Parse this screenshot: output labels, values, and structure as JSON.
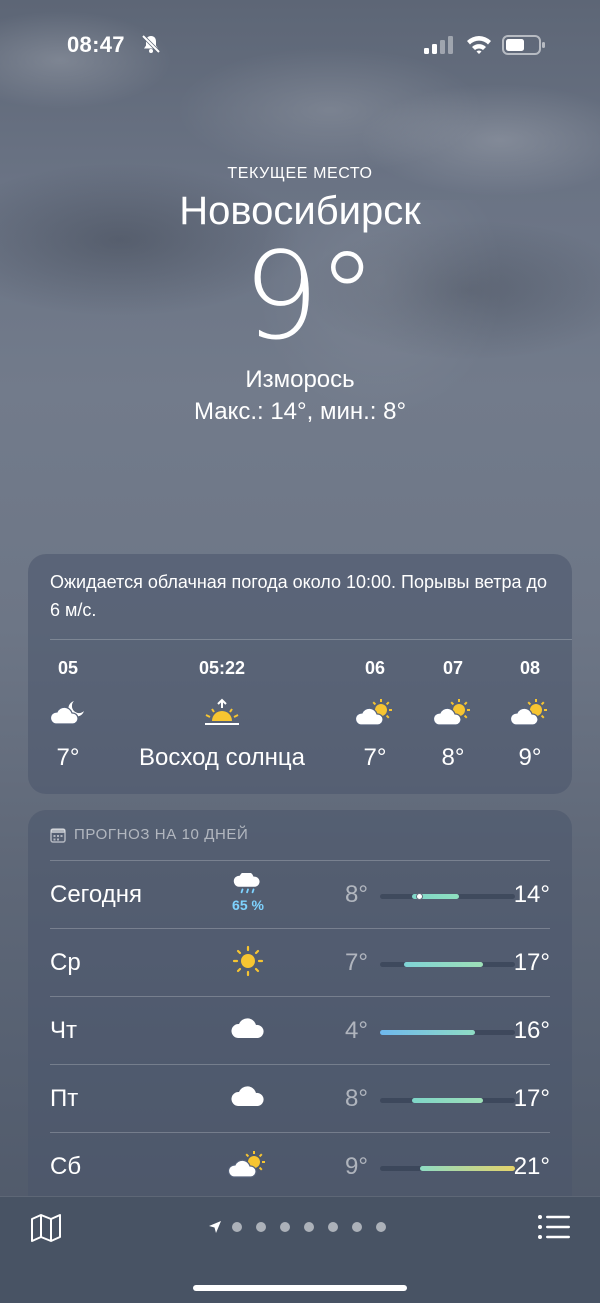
{
  "status_bar": {
    "time": "08:47",
    "icons": [
      "bell-slash-icon",
      "cellular-signal-icon",
      "wifi-icon",
      "battery-icon"
    ]
  },
  "location": {
    "label": "ТЕКУЩЕЕ МЕСТО",
    "city": "Новосибирск",
    "temperature": "9°",
    "condition": "Изморось",
    "range": "Макс.: 14°, мин.: 8°"
  },
  "hourly": {
    "summary": "Ожидается облачная погода около 10:00. Порывы ветра до 6 м/с.",
    "items": [
      {
        "time": "05",
        "icon": "partly-cloudy-night-icon",
        "temp": "7°"
      },
      {
        "time": "05:22",
        "icon": "sunrise-icon",
        "temp": "Восход солнца"
      },
      {
        "time": "06",
        "icon": "partly-cloudy-day-icon",
        "temp": "7°"
      },
      {
        "time": "07",
        "icon": "partly-cloudy-day-icon",
        "temp": "8°"
      },
      {
        "time": "08",
        "icon": "partly-cloudy-day-icon",
        "temp": "9°"
      }
    ]
  },
  "daily": {
    "header": "ПРОГНОЗ НА 10 ДНЕЙ",
    "range_scale": [
      4,
      21
    ],
    "days": [
      {
        "day": "Сегодня",
        "icon": "rain-cloud-icon",
        "precip": "65 %",
        "min": "8°",
        "max": "14°",
        "low": 8,
        "high": 14,
        "current": 9,
        "colors": [
          "#7fd6c8",
          "#8fe0c0"
        ]
      },
      {
        "day": "Ср",
        "icon": "sun-icon",
        "precip": "",
        "min": "7°",
        "max": "17°",
        "low": 7,
        "high": 17,
        "colors": [
          "#7fd3d6",
          "#9ee0b8"
        ]
      },
      {
        "day": "Чт",
        "icon": "cloud-icon",
        "precip": "",
        "min": "4°",
        "max": "16°",
        "low": 4,
        "high": 16,
        "colors": [
          "#6fb8ee",
          "#8fdcc4"
        ]
      },
      {
        "day": "Пт",
        "icon": "cloud-icon",
        "precip": "",
        "min": "8°",
        "max": "17°",
        "low": 8,
        "high": 17,
        "colors": [
          "#7fd6c8",
          "#9ee0b8"
        ]
      },
      {
        "day": "Сб",
        "icon": "partly-cloudy-day-icon",
        "precip": "",
        "min": "9°",
        "max": "21°",
        "low": 9,
        "high": 21,
        "colors": [
          "#8fdcc4",
          "#e6d36a"
        ]
      }
    ]
  },
  "bottom_bar": {
    "page_count": 7,
    "icons": [
      "map-icon",
      "location-arrow-icon",
      "list-icon"
    ]
  },
  "colors": {
    "precip_blue": "#7ed3ff",
    "sun_yellow": "#f7c531"
  }
}
